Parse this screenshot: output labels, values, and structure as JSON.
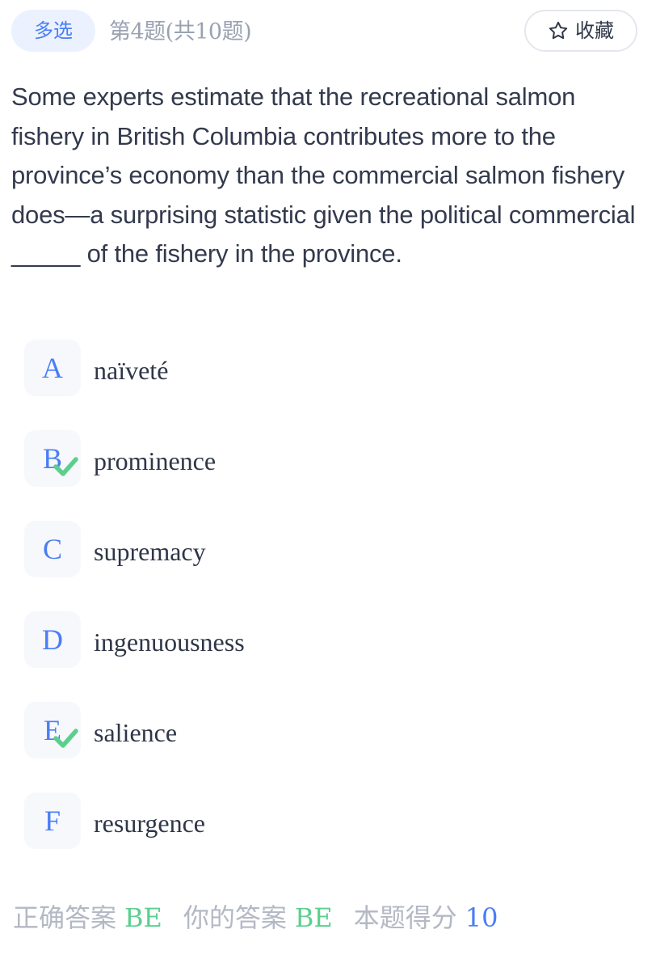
{
  "header": {
    "type_label": "多选",
    "progress": "第4题(共10题)",
    "favorite_label": "收藏",
    "favorite_icon": "star-outline-icon"
  },
  "question": {
    "text": "Some experts estimate that the recreational salmon fishery in British Columbia contributes more to the province’s economy than the commercial salmon fishery does—a surprising statistic given the political commercial _____ of the fishery in the province."
  },
  "options": [
    {
      "letter": "A",
      "text": "naïveté",
      "selected": false
    },
    {
      "letter": "B",
      "text": "prominence",
      "selected": true
    },
    {
      "letter": "C",
      "text": "supremacy",
      "selected": false
    },
    {
      "letter": "D",
      "text": "ingenuousness",
      "selected": false
    },
    {
      "letter": "E",
      "text": "salience",
      "selected": true
    },
    {
      "letter": "F",
      "text": "resurgence",
      "selected": false
    }
  ],
  "result": {
    "correct_label": "正确答案",
    "correct_value": "BE",
    "yours_label": "你的答案",
    "yours_value": "BE",
    "score_label": "本题得分",
    "score_value": "10"
  },
  "colors": {
    "accent": "#4a7ef5",
    "correct": "#5ccf8f",
    "muted": "#b3b9c4",
    "text": "#333a4d"
  }
}
